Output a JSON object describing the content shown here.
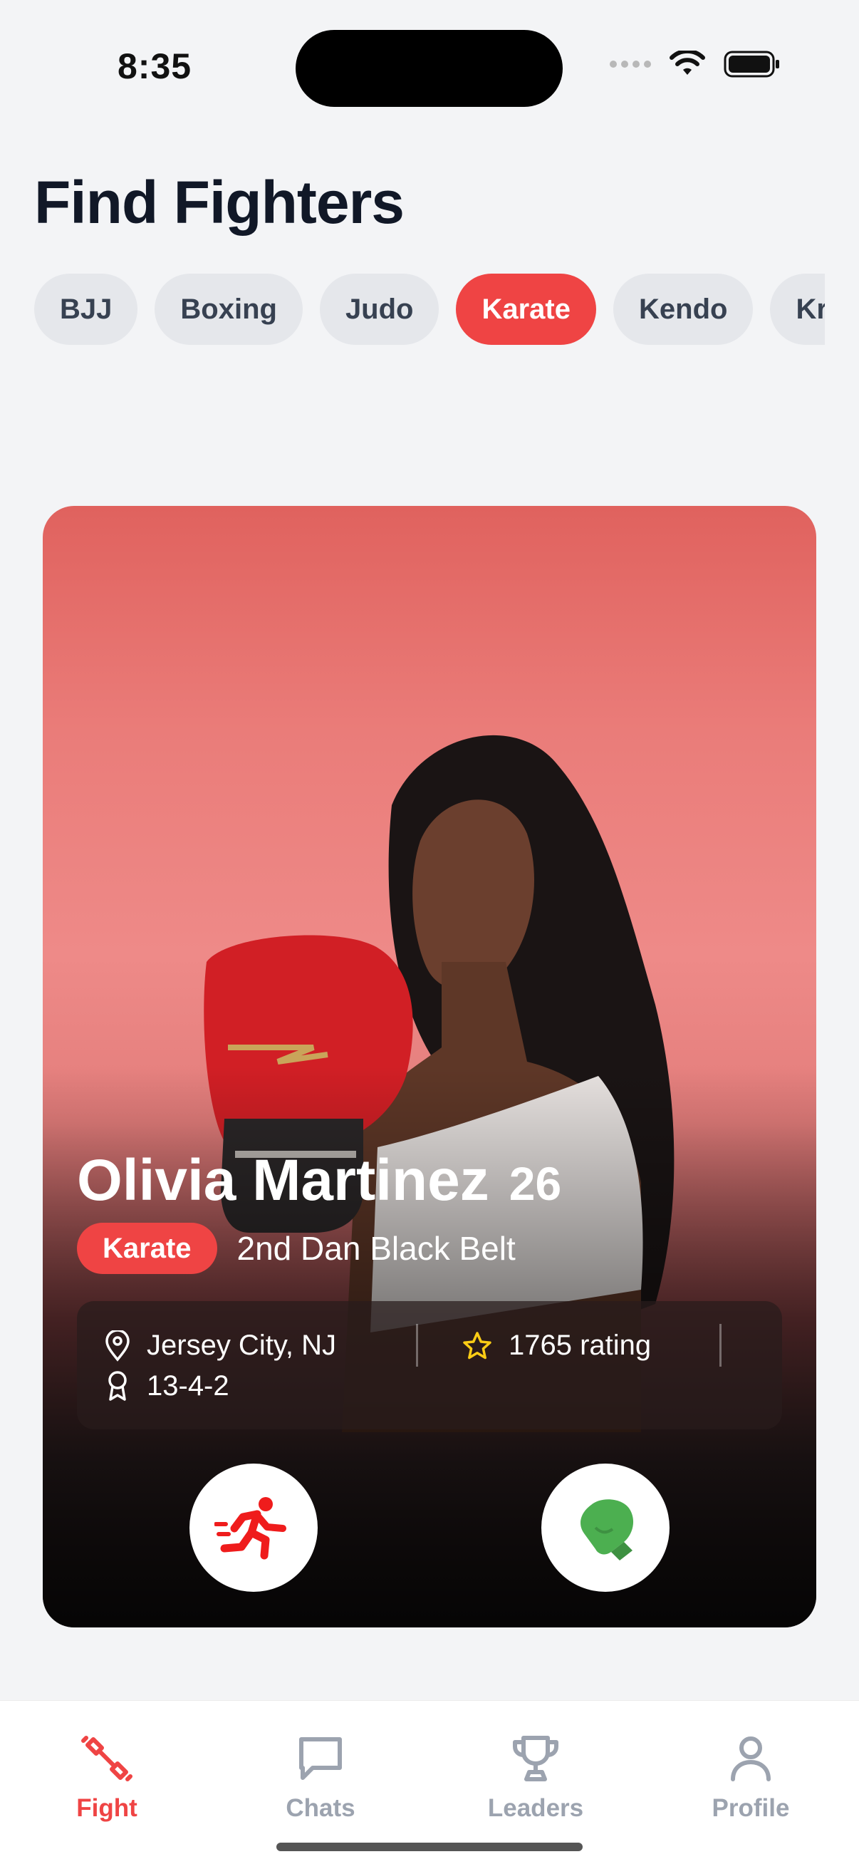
{
  "status_bar": {
    "time": "8:35"
  },
  "header": {
    "title": "Find Fighters"
  },
  "filters": {
    "chips": [
      "BJJ",
      "Boxing",
      "Judo",
      "Karate",
      "Kendo",
      "Krav Maga"
    ],
    "selected": "Karate"
  },
  "card": {
    "name": "Olivia Martinez",
    "age": "26",
    "discipline": "Karate",
    "rank": "2nd Dan Black Belt",
    "location": "Jersey City, NJ",
    "rating": "1765 rating",
    "record": "13-4-2",
    "actions": {
      "pass_icon": "running-person-icon",
      "fight_icon": "boxing-glove-icon"
    }
  },
  "tabs": [
    {
      "label": "Fight",
      "icon": "dumbbell-icon",
      "active": true
    },
    {
      "label": "Chats",
      "icon": "chat-bubble-icon",
      "active": false
    },
    {
      "label": "Leaders",
      "icon": "trophy-icon",
      "active": false
    },
    {
      "label": "Profile",
      "icon": "person-icon",
      "active": false
    }
  ],
  "colors": {
    "accent": "#ef4444",
    "fight_green": "#4caf50",
    "background": "#f3f4f6"
  }
}
